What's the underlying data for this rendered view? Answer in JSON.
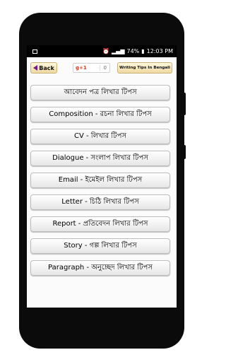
{
  "status_bar": {
    "battery": "74%",
    "time": "12:03 PM"
  },
  "toolbar": {
    "back_label": "Back",
    "gplus_label": "g+1",
    "gplus_count": "0",
    "tips_label": "Writing Tips In Bengali"
  },
  "menu": {
    "items": [
      {
        "label": "আবেদন পত্র লিখার টিপস"
      },
      {
        "label": "Composition - রচনা লিখার টিপস"
      },
      {
        "label": "CV - লিখার টিপস"
      },
      {
        "label": "Dialogue - সংলাপ লিখার টিপস"
      },
      {
        "label": "Email - ইমেইল লিখার টিপস"
      },
      {
        "label": "Letter - চিঠি লিখার টিপস"
      },
      {
        "label": "Report - প্রতিবেদন লিখার টিপস"
      },
      {
        "label": "Story - গল্প লিখার টিপস"
      },
      {
        "label": "Paragraph - অনুচ্ছেদ লিখার টিপস"
      }
    ]
  },
  "colors": {
    "phone_body": "#0b0b0b",
    "gplus_red": "#d0402a",
    "back_arrow": "#7a1a88"
  }
}
